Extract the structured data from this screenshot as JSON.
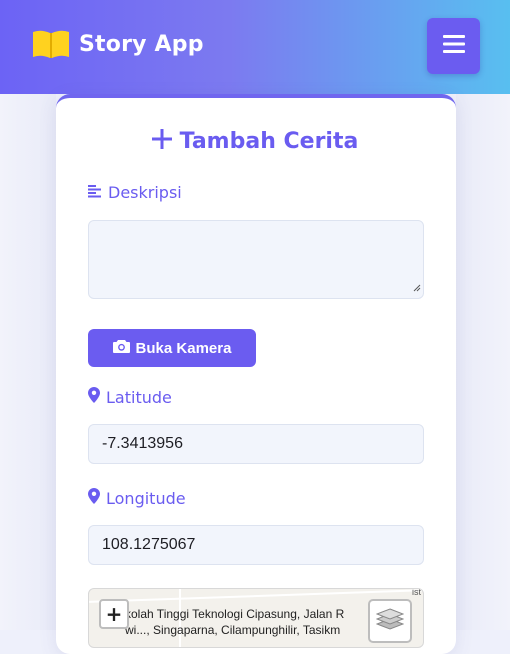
{
  "header": {
    "logo_icon": "open-book-icon",
    "app_name": "Story App",
    "menu_icon": "hamburger-icon"
  },
  "form": {
    "title": "Tambah Cerita",
    "title_icon": "plus-icon",
    "description": {
      "label": "Deskripsi",
      "icon": "align-left-icon",
      "value": ""
    },
    "camera_button": {
      "label": "Buka Kamera",
      "icon": "camera-icon"
    },
    "latitude": {
      "label": "Latitude",
      "icon": "map-pin-icon",
      "value": "-7.3413956"
    },
    "longitude": {
      "label": "Longitude",
      "icon": "map-pin-icon",
      "value": "108.1275067"
    }
  },
  "map": {
    "zoom_in_label": "+",
    "address_line1": "kolah Tinggi Teknologi Cipasung, Jalan R",
    "address_line2": "wi..., Singaparna, Cilampunghilir, Tasikm",
    "edge_text": "ist",
    "layers_icon": "layers-icon"
  },
  "colors": {
    "primary": "#6b5cf0",
    "header_gradient_start": "#6c63f5",
    "header_gradient_end": "#58bff0",
    "logo_yellow": "#ffd21f"
  }
}
